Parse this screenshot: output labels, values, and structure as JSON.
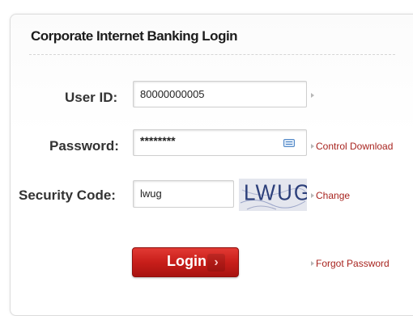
{
  "title": "Corporate Internet Banking Login",
  "fields": {
    "user_id": {
      "label": "User ID:",
      "value": "80000000005"
    },
    "password": {
      "label": "Password:",
      "value": "********"
    },
    "security_code": {
      "label": "Security Code:",
      "value": "lwug"
    }
  },
  "captcha": {
    "text": "LWUG"
  },
  "links": {
    "control_download": "Control Download",
    "change": "Change",
    "forgot_password": "Forgot Password"
  },
  "login_button": {
    "label": "Login",
    "chevron": "›"
  },
  "icons": [
    "keyboard-icon",
    "arrow-icon",
    "captcha-image"
  ],
  "colors": {
    "accent": "#c81e1a",
    "link": "#a8241f"
  }
}
